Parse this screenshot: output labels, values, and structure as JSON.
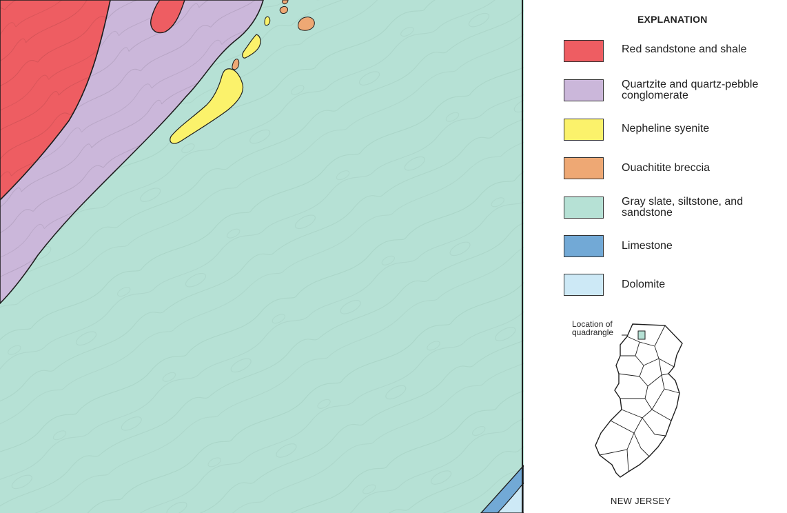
{
  "map": {
    "units": {
      "red_sandstone": "#ee5d62",
      "quartzite": "#cbb7da",
      "nepheline": "#fbf26b",
      "ouachitite": "#eea874",
      "gray_slate": "#b6e1d5",
      "limestone": "#72a9d6",
      "dolomite": "#cde9f6"
    },
    "contour_color": "#9fc9bc",
    "boundary_color": "#1e1e1e"
  },
  "legend": {
    "title": "EXPLANATION",
    "items": [
      {
        "label": "Red sandstone and shale",
        "color": "#ee5d62"
      },
      {
        "label": "Quartzite and quartz-pebble conglomerate",
        "color": "#cbb7da"
      },
      {
        "label": "Nepheline syenite",
        "color": "#fbf26b"
      },
      {
        "label": "Ouachitite breccia",
        "color": "#eea874"
      },
      {
        "label": "Gray slate, siltstone, and sandstone",
        "color": "#b6e1d5"
      },
      {
        "label": "Limestone",
        "color": "#72a9d6"
      },
      {
        "label": "Dolomite",
        "color": "#cde9f6"
      }
    ]
  },
  "inset": {
    "caption": "Location of quadrangle",
    "state_name": "NEW JERSEY",
    "marker_color": "#b6e1d5"
  }
}
